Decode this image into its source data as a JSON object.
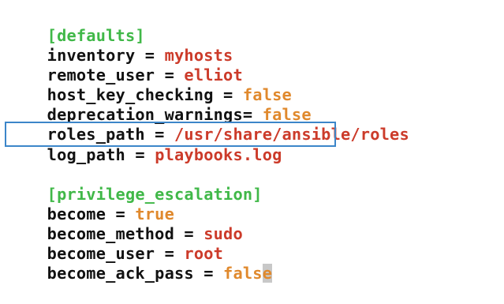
{
  "editor": {
    "lines": [
      {
        "section": "[defaults]"
      },
      {
        "key": "inventory",
        "op": " = ",
        "value": "myhosts",
        "value_color": "red"
      },
      {
        "key": "remote_user",
        "op": " = ",
        "value": "elliot",
        "value_color": "red"
      },
      {
        "key": "host_key_checking",
        "op": " = ",
        "value": "false",
        "value_color": "orange"
      },
      {
        "key": "deprecation_warnings",
        "op": "= ",
        "value": "false",
        "value_color": "orange"
      },
      {
        "key": "roles_path",
        "op": " = ",
        "value": "/usr/share/ansible/roles",
        "value_color": "red"
      },
      {
        "key": "log_path",
        "op": " = ",
        "value": "playbooks.log",
        "value_color": "red",
        "highlighted": true
      },
      {
        "blank": true
      },
      {
        "section": "[privilege_escalation]"
      },
      {
        "key": "become",
        "op": " = ",
        "value": "true",
        "value_color": "orange"
      },
      {
        "key": "become_method",
        "op": " = ",
        "value": "sudo",
        "value_color": "red"
      },
      {
        "key": "become_user",
        "op": " = ",
        "value": "root",
        "value_color": "red"
      },
      {
        "key": "become_ack_pass",
        "op": " = ",
        "value_before_cursor": "fals",
        "value_cursor_char": "e",
        "value_color": "orange",
        "has_cursor": true
      }
    ]
  },
  "colors": {
    "section": "#40b848",
    "key": "#111111",
    "value_red": "#cc3b2a",
    "value_orange": "#e0892d",
    "highlight_border": "#3c86c9",
    "cursor_bg": "#c8c8c8"
  }
}
